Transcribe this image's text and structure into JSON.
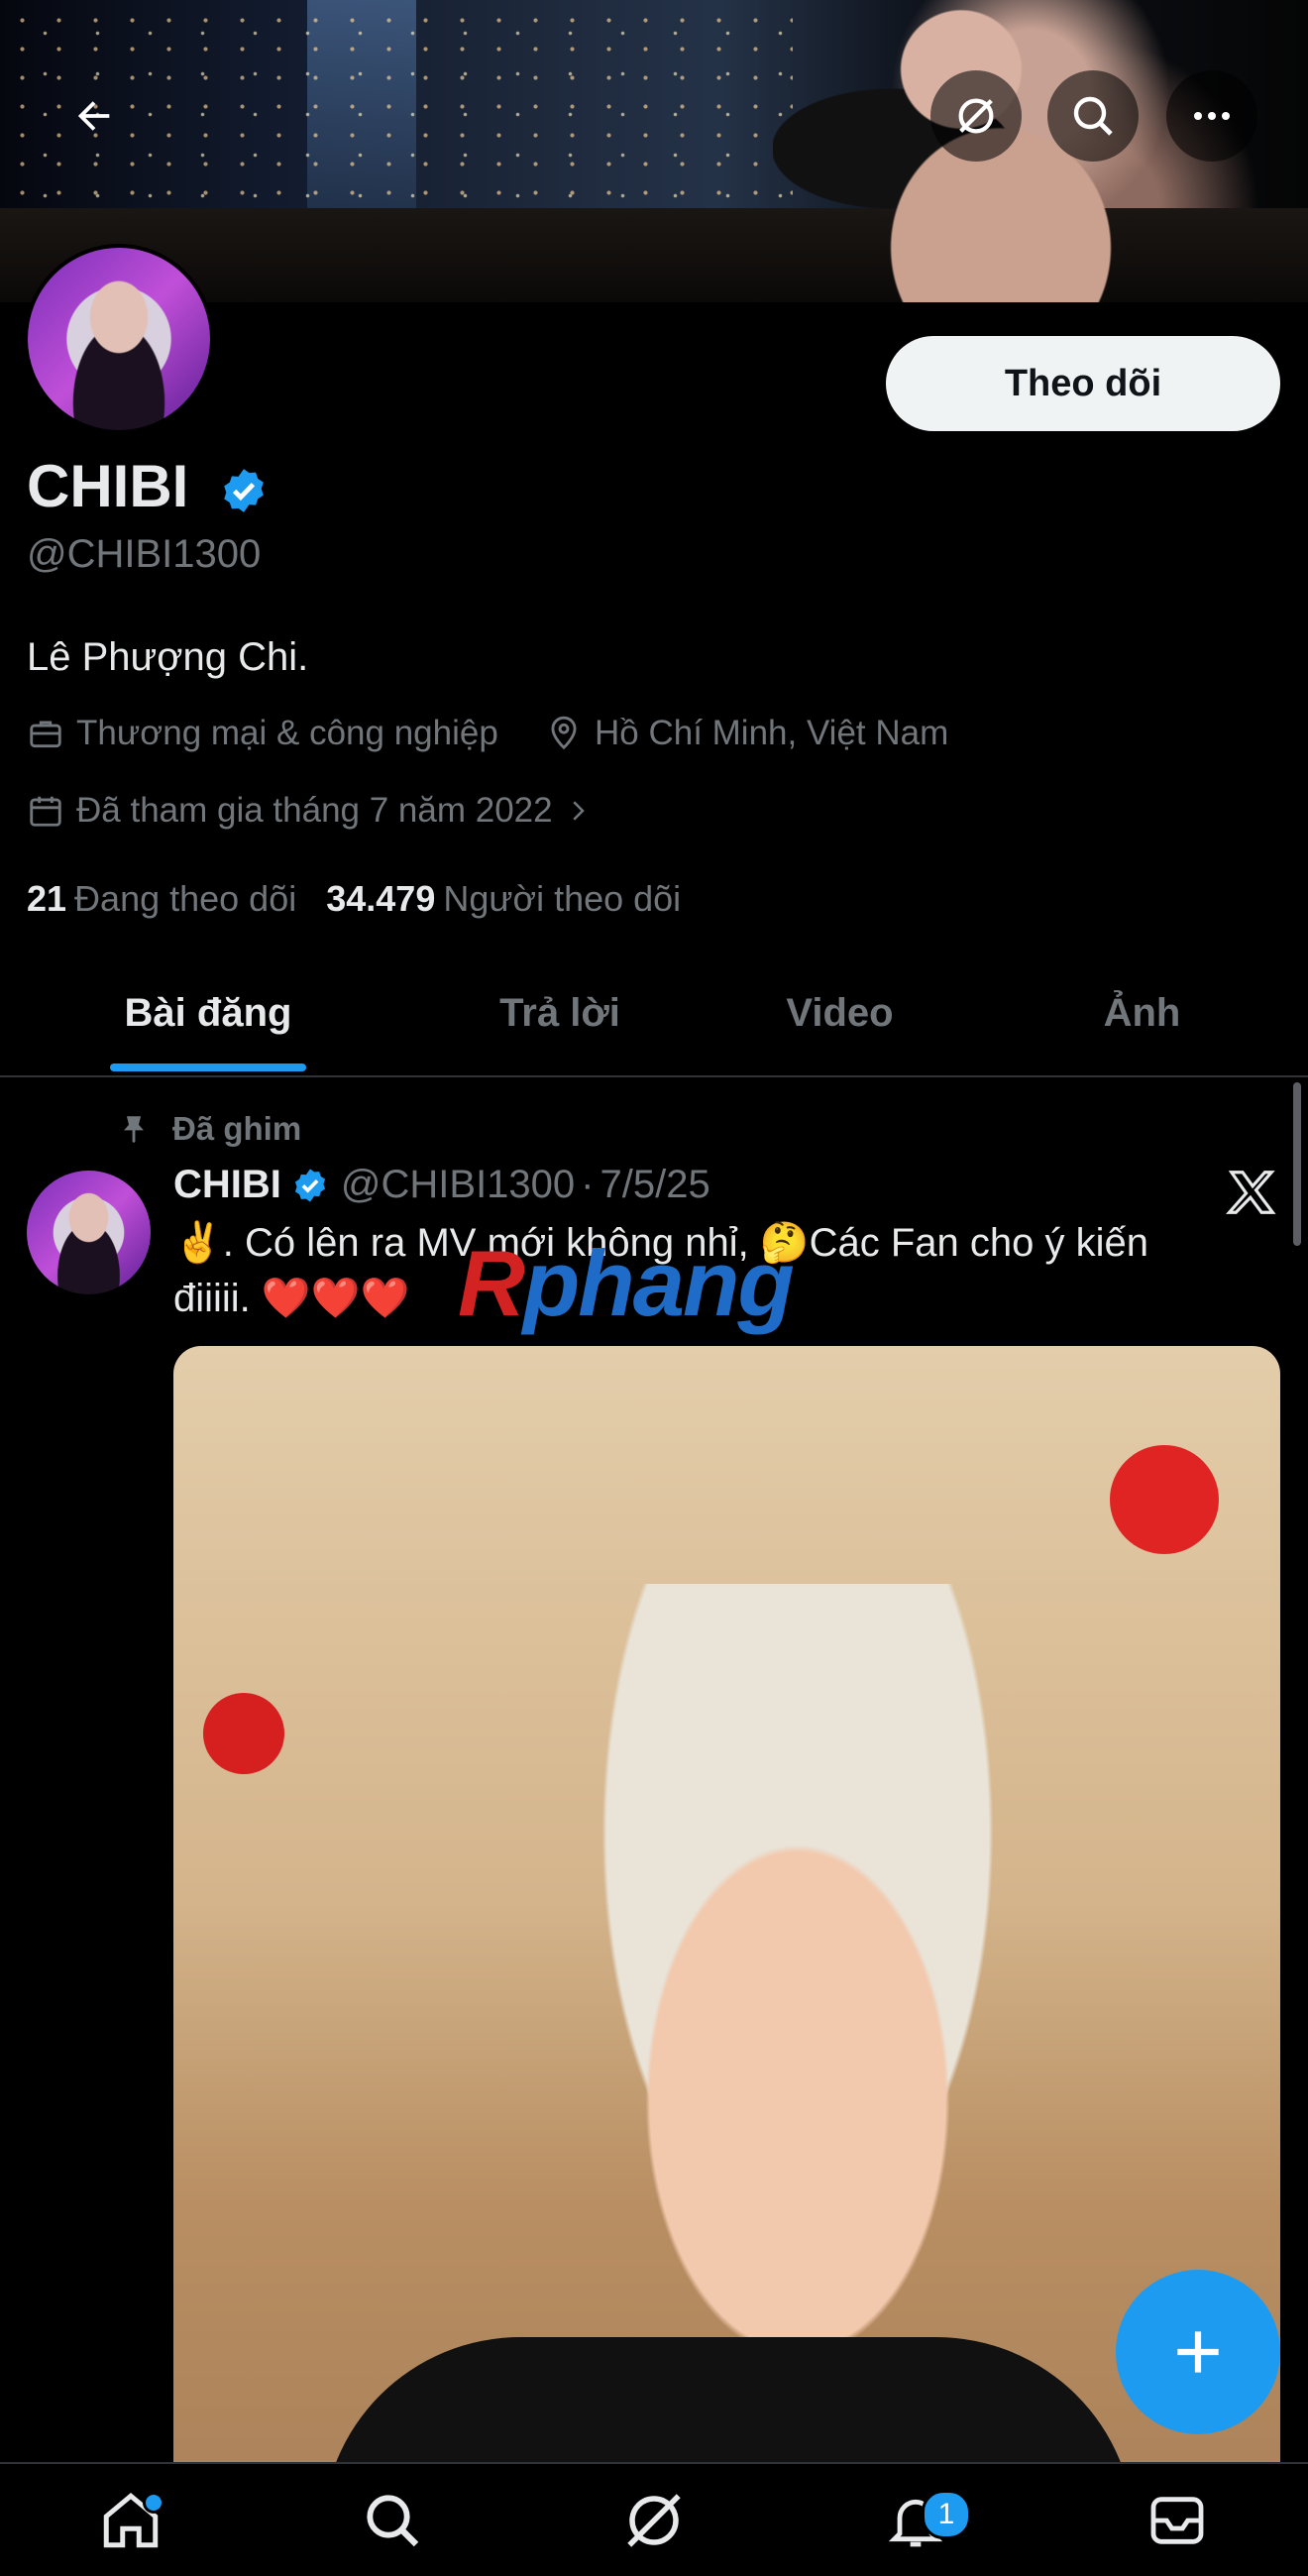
{
  "header": {
    "back_icon": "arrow-left-icon",
    "grok_icon": "grok-icon",
    "search_icon": "search-icon",
    "more_icon": "more-horizontal-icon"
  },
  "profile": {
    "display_name": "CHIBI",
    "verified": true,
    "handle": "@CHIBI1300",
    "bio": "Lê Phượng Chi.",
    "category": "Thương mại & công nghiệp",
    "location": "Hồ Chí Minh, Việt Nam",
    "joined": "Đã tham gia tháng 7 năm 2022",
    "follow_label": "Theo dõi",
    "following_count": "21",
    "following_label": "Đang theo dõi",
    "followers_count": "34.479",
    "followers_label": "Người theo dõi"
  },
  "tabs": [
    {
      "label": "Bài đăng",
      "active": true
    },
    {
      "label": "Trả lời",
      "active": false
    },
    {
      "label": "Video",
      "active": false
    },
    {
      "label": "Ảnh",
      "active": false
    }
  ],
  "tweet": {
    "pinned_label": "Đã ghim",
    "author": "CHIBI",
    "handle": "@CHIBI1300",
    "separator": "·",
    "date": "7/5/25",
    "text": "✌️. Có lên ra MV mới không nhỉ, 🤔Các Fan cho ý kiến điiiii. ❤️❤️❤️",
    "source_icon": "x-logo-icon"
  },
  "watermark": {
    "part1": "R",
    "part2": "phang"
  },
  "bottom_nav": {
    "items": [
      "home-icon",
      "search-icon",
      "grok-icon",
      "notifications-icon",
      "messages-icon"
    ],
    "notification_badge": "1"
  },
  "colors": {
    "accent": "#1d9bf0",
    "background": "#000000",
    "muted": "#71767b"
  }
}
